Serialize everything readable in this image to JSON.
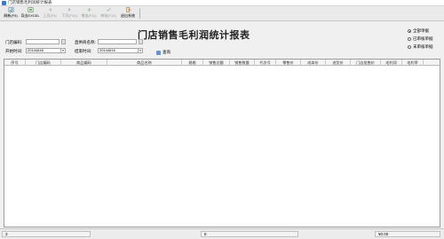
{
  "window": {
    "title": "门店销售毛利润统计报表"
  },
  "toolbar": {
    "buttons": [
      {
        "label": "刷新(F5)",
        "icon": "refresh-icon",
        "enabled": true
      },
      {
        "label": "导出EXCEL",
        "icon": "excel-export-icon",
        "enabled": true
      },
      {
        "label": "上页(F6)",
        "icon": "previous-page-icon",
        "enabled": false
      },
      {
        "label": "下页(F10)",
        "icon": "next-page-icon",
        "enabled": false
      },
      {
        "label": "增加(F11)",
        "icon": "add-icon",
        "enabled": false
      },
      {
        "label": "审核(F12)",
        "icon": "audit-icon",
        "enabled": false
      },
      {
        "label": "退出系统",
        "icon": "exit-icon",
        "enabled": true
      }
    ]
  },
  "report": {
    "title": "门店销售毛利润统计报表"
  },
  "filters": {
    "store_code_label": "门店编码:",
    "store_code_value": "",
    "supplier_name_label": "直供商名称:",
    "supplier_name_value": "",
    "start_time_label": "开始时间:",
    "start_time_value": "20144648",
    "end_time_label": "结束时间:",
    "end_time_value": "20144616",
    "query_label": "查询"
  },
  "options": {
    "items": [
      {
        "label": "全部单据",
        "checked": true
      },
      {
        "label": "已审核单据",
        "checked": false
      },
      {
        "label": "未审核单据",
        "checked": false
      }
    ]
  },
  "grid": {
    "columns": [
      "序号",
      "门店编码",
      "商品编码",
      "商品名称",
      "规格",
      "销售总额",
      "销售数量",
      "代次号",
      "零售价",
      "成本价",
      "进货价",
      "门店批售价",
      "毛利润",
      "毛利率"
    ]
  },
  "status": {
    "left": "3",
    "middle": "8",
    "right": "¥0.00"
  }
}
